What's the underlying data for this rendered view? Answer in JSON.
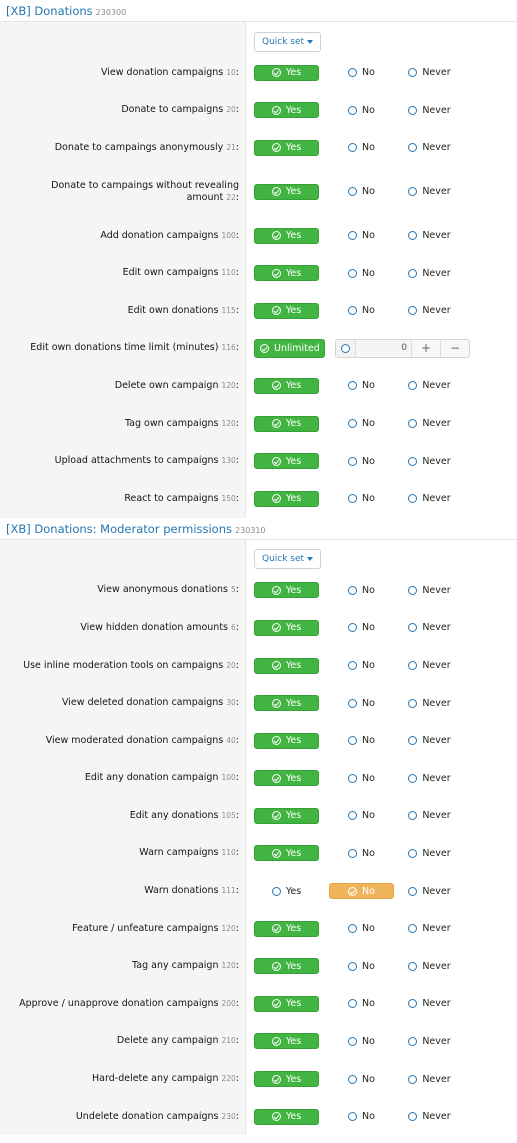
{
  "sections": [
    {
      "title": "[XB] Donations",
      "id": "230300",
      "quick_set_label": "Quick set",
      "rows": [
        {
          "label": "View donation campaigns",
          "num": "10",
          "sel": "yes"
        },
        {
          "label": "Donate to campaigns",
          "num": "20",
          "sel": "yes"
        },
        {
          "label": "Donate to campaings anonymously",
          "num": "21",
          "sel": "yes"
        },
        {
          "label": "Donate to campaings without revealing amount",
          "num": "22",
          "sel": "yes",
          "tall": true
        },
        {
          "label": "Add donation campaigns",
          "num": "100",
          "sel": "yes"
        },
        {
          "label": "Edit own campaigns",
          "num": "110",
          "sel": "yes"
        },
        {
          "label": "Edit own donations",
          "num": "115",
          "sel": "yes"
        },
        {
          "label": "Edit own donations time limit (minutes)",
          "num": "116",
          "type": "number",
          "unlimited_label": "Unlimited",
          "value": "0"
        },
        {
          "label": "Delete own campaign",
          "num": "120",
          "sel": "yes"
        },
        {
          "label": "Tag own campaigns",
          "num": "120",
          "sel": "yes"
        },
        {
          "label": "Upload attachments to campaigns",
          "num": "130",
          "sel": "yes"
        },
        {
          "label": "React to campaigns",
          "num": "150",
          "sel": "yes"
        }
      ]
    },
    {
      "title": "[XB] Donations: Moderator permissions",
      "id": "230310",
      "quick_set_label": "Quick set",
      "rows": [
        {
          "label": "View anonymous donations",
          "num": "5",
          "sel": "yes"
        },
        {
          "label": "View hidden donation amounts",
          "num": "6",
          "sel": "yes"
        },
        {
          "label": "Use inline moderation tools on campaigns",
          "num": "20",
          "sel": "yes"
        },
        {
          "label": "View deleted donation campaigns",
          "num": "30",
          "sel": "yes"
        },
        {
          "label": "View moderated donation campaigns",
          "num": "40",
          "sel": "yes"
        },
        {
          "label": "Edit any donation campaign",
          "num": "100",
          "sel": "yes"
        },
        {
          "label": "Edit any donations",
          "num": "105",
          "sel": "yes"
        },
        {
          "label": "Warn campaigns",
          "num": "110",
          "sel": "yes"
        },
        {
          "label": "Warn donations",
          "num": "111",
          "sel": "no"
        },
        {
          "label": "Feature / unfeature campaigns",
          "num": "120",
          "sel": "yes"
        },
        {
          "label": "Tag any campaign",
          "num": "120",
          "sel": "yes"
        },
        {
          "label": "Approve / unapprove donation campaigns",
          "num": "200",
          "sel": "yes"
        },
        {
          "label": "Delete any campaign",
          "num": "210",
          "sel": "yes"
        },
        {
          "label": "Hard-delete any campaign",
          "num": "220",
          "sel": "yes"
        },
        {
          "label": "Undelete donation campaigns",
          "num": "230",
          "sel": "yes"
        }
      ]
    }
  ],
  "option_labels": {
    "yes": "Yes",
    "no": "No",
    "never": "Never"
  },
  "colors": {
    "accent": "#2577b1",
    "yes": "#42b442",
    "no": "#f0b55c"
  }
}
